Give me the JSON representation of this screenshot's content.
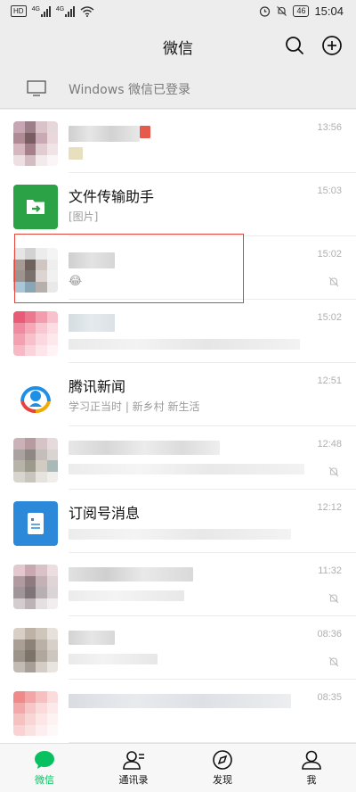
{
  "status_bar": {
    "hd_label": "HD",
    "network_1": "4G",
    "network_2": "4G",
    "battery": "46",
    "time": "15:04"
  },
  "header": {
    "title": "微信",
    "search_icon": "search-icon",
    "add_icon": "plus-circle-icon"
  },
  "windows_bar": {
    "text": "Windows 微信已登录",
    "icon": "monitor-icon"
  },
  "chats": [
    {
      "name": "",
      "preview": "",
      "time": "13:56",
      "muted": false,
      "blurred": true
    },
    {
      "name": "文件传输助手",
      "preview": "[图片]",
      "time": "15:03",
      "muted": false,
      "avatar_color": "#2ba245"
    },
    {
      "name": "",
      "preview": "😂",
      "time": "15:02",
      "muted": true,
      "blurred": true
    },
    {
      "name": "",
      "preview": "",
      "time": "15:02",
      "muted": false,
      "blurred": true
    },
    {
      "name": "腾讯新闻",
      "preview": "学习正当时 | 新乡村 新生活",
      "time": "12:51",
      "muted": false
    },
    {
      "name": "",
      "preview": "",
      "time": "12:48",
      "muted": true,
      "blurred": true
    },
    {
      "name": "订阅号消息",
      "preview": "",
      "time": "12:12",
      "muted": false,
      "avatar_color": "#2c89d9"
    },
    {
      "name": "",
      "preview": "",
      "time": "11:32",
      "muted": true,
      "blurred": true
    },
    {
      "name": "",
      "preview": "",
      "time": "08:36",
      "muted": true,
      "blurred": true
    },
    {
      "name": "",
      "preview": "",
      "time": "08:35",
      "muted": false,
      "blurred": true
    }
  ],
  "tabs": [
    {
      "label": "微信",
      "icon": "chat-bubble-icon",
      "active": true
    },
    {
      "label": "通讯录",
      "icon": "contacts-icon",
      "active": false
    },
    {
      "label": "发现",
      "icon": "compass-icon",
      "active": false
    },
    {
      "label": "我",
      "icon": "person-icon",
      "active": false
    }
  ],
  "colors": {
    "accent": "#07c160",
    "highlight_box": "#e2463b"
  }
}
